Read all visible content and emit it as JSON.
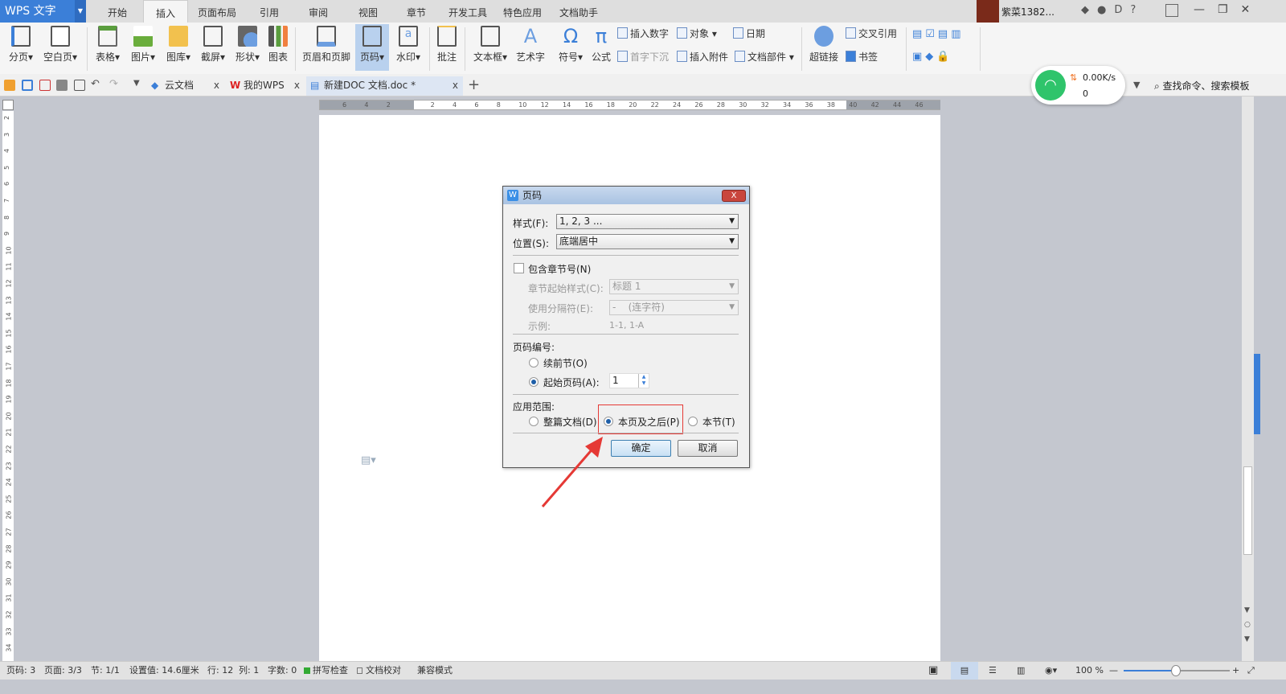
{
  "app": {
    "title": "WPS 文字",
    "user": "紫菜1382..."
  },
  "menu_tabs": [
    "开始",
    "插入",
    "页面布局",
    "引用",
    "审阅",
    "视图",
    "章节",
    "开发工具",
    "特色应用",
    "文档助手"
  ],
  "ribbon": {
    "large": [
      "分页",
      "空白页",
      "表格",
      "图片",
      "图库",
      "截屏",
      "形状",
      "图表",
      "页眉和页脚",
      "页码",
      "水印",
      "批注",
      "文本框",
      "艺术字",
      "符号",
      "公式"
    ],
    "small": [
      "插入数字",
      "对象",
      "日期",
      "首字下沉",
      "插入附件",
      "文档部件"
    ],
    "large2": [
      "超链接"
    ],
    "small2": [
      "交叉引用",
      "书签"
    ]
  },
  "doc_tabs": [
    {
      "label": "云文档"
    },
    {
      "label": "我的WPS"
    },
    {
      "label": "新建DOC 文档.doc *"
    }
  ],
  "network": {
    "speed": "0.00K/s",
    "count": "0"
  },
  "search": {
    "placeholder": "查找命令、搜索模板"
  },
  "ruler_h": [
    "6",
    "4",
    "2",
    "",
    "2",
    "4",
    "6",
    "8",
    "10",
    "12",
    "14",
    "16",
    "18",
    "20",
    "22",
    "24",
    "26",
    "28",
    "30",
    "32",
    "34",
    "36",
    "38",
    "40",
    "42",
    "44",
    "46"
  ],
  "dialog": {
    "title": "页码",
    "close": "X",
    "style_label": "样式(F):",
    "style_value": "1, 2, 3 ...",
    "position_label": "位置(S):",
    "position_value": "底端居中",
    "include_chapter": "包含章节号(N)",
    "chapter_style_label": "章节起始样式(C):",
    "chapter_style_value": "标题 1",
    "separator_label": "使用分隔符(E):",
    "separator_value": "-    (连字符)",
    "example_label": "示例:",
    "example_value": "1-1, 1-A",
    "numbering_label": "页码编号:",
    "continue": "续前节(O)",
    "start_at": "起始页码(A):",
    "start_value": "1",
    "scope_label": "应用范围:",
    "scope_whole": "整篇文档(D)",
    "scope_after": "本页及之后(P)",
    "scope_section": "本节(T)",
    "ok": "确定",
    "cancel": "取消"
  },
  "status": {
    "page": "页码: 3",
    "pages": "页面: 3/3",
    "section": "节: 1/1",
    "setting": "设置值: 14.6厘米",
    "row": "行: 12",
    "col": "列: 1",
    "words": "字数: 0",
    "spell": "拼写检查",
    "proof": "文档校对",
    "mode": "兼容模式",
    "zoom": "100 %"
  },
  "colors": {
    "accent": "#3b7fd8",
    "highlight": "#e53935"
  }
}
